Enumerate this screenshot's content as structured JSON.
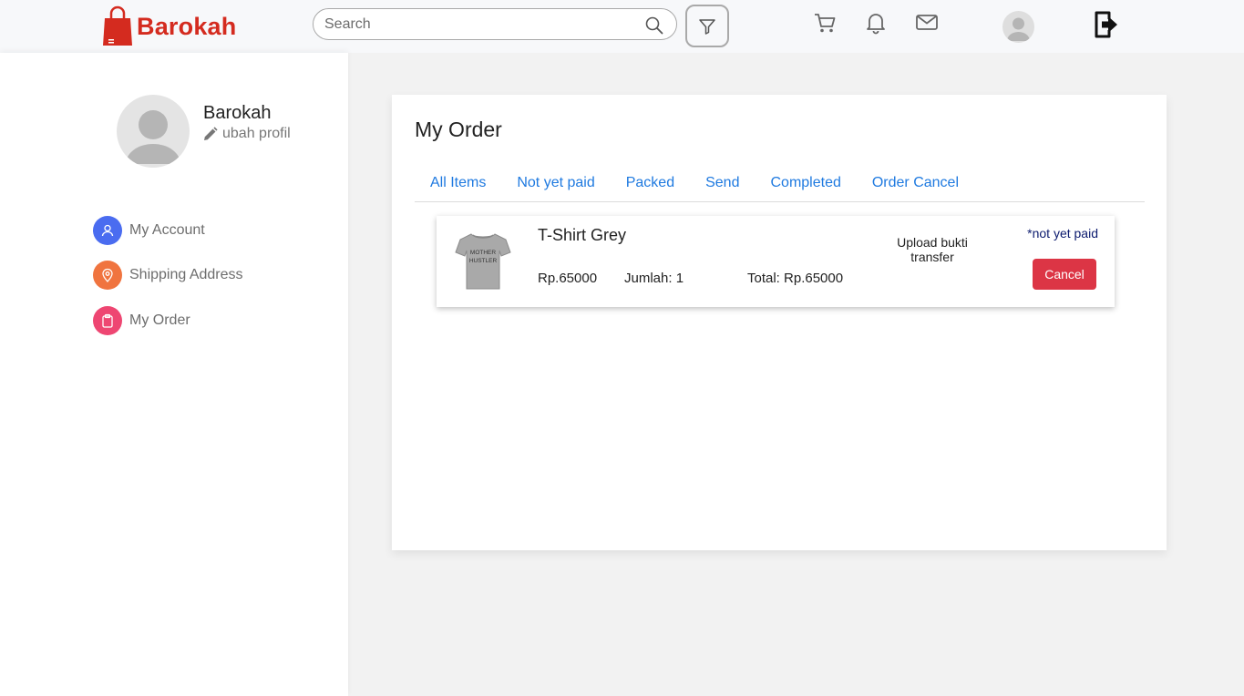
{
  "header": {
    "brand": "Barokah",
    "search_placeholder": "Search"
  },
  "sidebar": {
    "profile_name": "Barokah",
    "edit_profile": "ubah profil",
    "menu": [
      {
        "label": "My Account",
        "icon": "user-icon",
        "color": "#4a6cf0"
      },
      {
        "label": "Shipping Address",
        "icon": "location-pin-icon",
        "color": "#f0743f"
      },
      {
        "label": "My Order",
        "icon": "clipboard-icon",
        "color": "#ee4672"
      }
    ]
  },
  "main": {
    "title": "My Order",
    "tabs": [
      "All Items",
      "Not yet paid",
      "Packed",
      "Send",
      "Completed",
      "Order Cancel"
    ],
    "orders": [
      {
        "product_name": "T-Shirt Grey",
        "price": "Rp.65000",
        "quantity": "Jumlah: 1",
        "total": "Total: Rp.65000",
        "upload_label": "Upload bukti transfer",
        "status": "*not yet paid",
        "cancel_label": "Cancel",
        "image": "grey-tshirt-image"
      }
    ]
  },
  "colors": {
    "brand": "#d42b1f",
    "tab_link": "#1f7ae0",
    "cancel": "#dc3545",
    "status": "#0b1a6e"
  }
}
